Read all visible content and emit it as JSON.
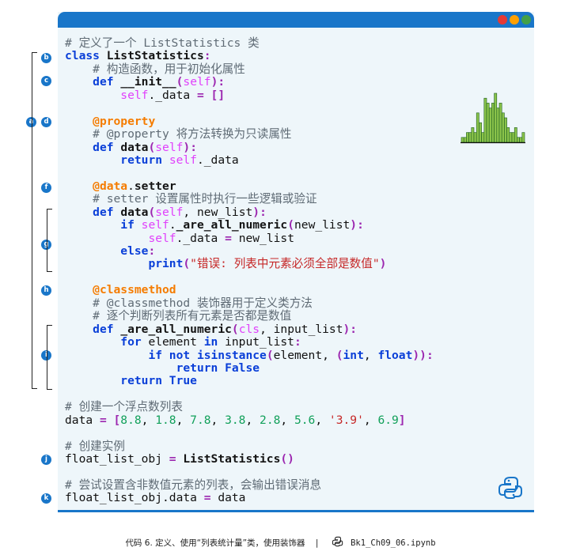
{
  "window": {
    "traffic_lights": [
      "#e53935",
      "#ffa000",
      "#43a047"
    ],
    "accent": "#1976c9"
  },
  "code_lines": [
    [
      [
        "c",
        "# 定义了一个 ListStatistics 类"
      ]
    ],
    [
      [
        "kw",
        "class "
      ],
      [
        "fn",
        "ListStatistics"
      ],
      [
        "op",
        ":"
      ]
    ],
    [
      [
        "tx",
        "    "
      ],
      [
        "c",
        "# 构造函数，用于初始化属性"
      ]
    ],
    [
      [
        "tx",
        "    "
      ],
      [
        "kw",
        "def "
      ],
      [
        "fn",
        "__init__"
      ],
      [
        "op",
        "("
      ],
      [
        "mg",
        "self"
      ],
      [
        "op",
        "):"
      ]
    ],
    [
      [
        "tx",
        "        "
      ],
      [
        "mg",
        "self"
      ],
      [
        "tx",
        "._data "
      ],
      [
        "op",
        "= []"
      ]
    ],
    [],
    [
      [
        "tx",
        "    "
      ],
      [
        "dc",
        "@property"
      ]
    ],
    [
      [
        "tx",
        "    "
      ],
      [
        "c",
        "# @property 将方法转换为只读属性"
      ]
    ],
    [
      [
        "tx",
        "    "
      ],
      [
        "kw",
        "def "
      ],
      [
        "fn",
        "data"
      ],
      [
        "op",
        "("
      ],
      [
        "mg",
        "self"
      ],
      [
        "op",
        "):"
      ]
    ],
    [
      [
        "tx",
        "        "
      ],
      [
        "kw",
        "return "
      ],
      [
        "mg",
        "self"
      ],
      [
        "tx",
        "._data"
      ]
    ],
    [],
    [
      [
        "tx",
        "    "
      ],
      [
        "dc",
        "@data"
      ],
      [
        "tx",
        "."
      ],
      [
        "fn",
        "setter"
      ]
    ],
    [
      [
        "tx",
        "    "
      ],
      [
        "c",
        "# setter 设置属性时执行一些逻辑或验证"
      ]
    ],
    [
      [
        "tx",
        "    "
      ],
      [
        "kw",
        "def "
      ],
      [
        "fn",
        "data"
      ],
      [
        "op",
        "("
      ],
      [
        "mg",
        "self"
      ],
      [
        "tx",
        ", new_list"
      ],
      [
        "op",
        "):"
      ]
    ],
    [
      [
        "tx",
        "        "
      ],
      [
        "kw",
        "if "
      ],
      [
        "mg",
        "self"
      ],
      [
        "tx",
        "."
      ],
      [
        "fn",
        "_are_all_numeric"
      ],
      [
        "op",
        "("
      ],
      [
        "tx",
        "new_list"
      ],
      [
        "op",
        "):"
      ]
    ],
    [
      [
        "tx",
        "            "
      ],
      [
        "mg",
        "self"
      ],
      [
        "tx",
        "._data "
      ],
      [
        "op",
        "="
      ],
      [
        "tx",
        " new_list"
      ]
    ],
    [
      [
        "tx",
        "        "
      ],
      [
        "kw",
        "else"
      ],
      [
        "op",
        ":"
      ]
    ],
    [
      [
        "tx",
        "            "
      ],
      [
        "kw",
        "print"
      ],
      [
        "op",
        "("
      ],
      [
        "st",
        "\"错误: 列表中元素必须全部是数值\""
      ],
      [
        "op",
        ")"
      ]
    ],
    [],
    [
      [
        "tx",
        "    "
      ],
      [
        "dc",
        "@classmethod"
      ]
    ],
    [
      [
        "tx",
        "    "
      ],
      [
        "c",
        "# @classmethod 装饰器用于定义类方法"
      ]
    ],
    [
      [
        "tx",
        "    "
      ],
      [
        "c",
        "# 逐个判断列表所有元素是否都是数值"
      ]
    ],
    [
      [
        "tx",
        "    "
      ],
      [
        "kw",
        "def "
      ],
      [
        "fn",
        "_are_all_numeric"
      ],
      [
        "op",
        "("
      ],
      [
        "mg",
        "cls"
      ],
      [
        "tx",
        ", input_list"
      ],
      [
        "op",
        "):"
      ]
    ],
    [
      [
        "tx",
        "        "
      ],
      [
        "kw",
        "for "
      ],
      [
        "tx",
        "element "
      ],
      [
        "kw",
        "in "
      ],
      [
        "tx",
        "input_list"
      ],
      [
        "op",
        ":"
      ]
    ],
    [
      [
        "tx",
        "            "
      ],
      [
        "kw",
        "if not "
      ],
      [
        "kw",
        "isinstance"
      ],
      [
        "op",
        "("
      ],
      [
        "tx",
        "element, "
      ],
      [
        "op",
        "("
      ],
      [
        "kw",
        "int"
      ],
      [
        "tx",
        ", "
      ],
      [
        "kw",
        "float"
      ],
      [
        "op",
        "))"
      ],
      [
        "op",
        ":"
      ]
    ],
    [
      [
        "tx",
        "                "
      ],
      [
        "kw",
        "return False"
      ]
    ],
    [
      [
        "tx",
        "        "
      ],
      [
        "kw",
        "return True"
      ]
    ],
    [],
    [
      [
        "c",
        "# 创建一个浮点数列表"
      ]
    ],
    [
      [
        "tx",
        "data "
      ],
      [
        "op",
        "= ["
      ],
      [
        "nu",
        "8.8"
      ],
      [
        "tx",
        ", "
      ],
      [
        "nu",
        "1.8"
      ],
      [
        "tx",
        ", "
      ],
      [
        "nu",
        "7.8"
      ],
      [
        "tx",
        ", "
      ],
      [
        "nu",
        "3.8"
      ],
      [
        "tx",
        ", "
      ],
      [
        "nu",
        "2.8"
      ],
      [
        "tx",
        ", "
      ],
      [
        "nu",
        "5.6"
      ],
      [
        "tx",
        ", "
      ],
      [
        "st",
        "'3.9'"
      ],
      [
        "tx",
        ", "
      ],
      [
        "nu",
        "6.9"
      ],
      [
        "op",
        "]"
      ]
    ],
    [],
    [
      [
        "c",
        "# 创建实例"
      ]
    ],
    [
      [
        "tx",
        "float_list_obj "
      ],
      [
        "op",
        "= "
      ],
      [
        "fn",
        "ListStatistics"
      ],
      [
        "op",
        "()"
      ]
    ],
    [],
    [
      [
        "c",
        "# 尝试设置含非数值元素的列表，会输出错误消息"
      ]
    ],
    [
      [
        "tx",
        "float_list_obj.data "
      ],
      [
        "op",
        "= "
      ],
      [
        "tx",
        "data"
      ]
    ]
  ],
  "badges": [
    "a",
    "b",
    "c",
    "d",
    "f",
    "g",
    "h",
    "i",
    "j",
    "k"
  ],
  "histogram": {
    "color": "#8bc34a",
    "edge": "#1b5e20",
    "values": [
      1,
      1,
      2,
      2,
      3,
      2,
      6,
      4,
      2,
      9,
      8,
      7,
      8,
      10,
      7,
      8,
      6,
      5,
      3,
      2,
      2,
      3,
      1,
      1,
      2
    ]
  },
  "caption": {
    "text": "代码 6. 定义、使用“列表统计量”类，使用装饰器",
    "separator": "|",
    "filename": "Bk1_Ch09_06.ipynb"
  }
}
